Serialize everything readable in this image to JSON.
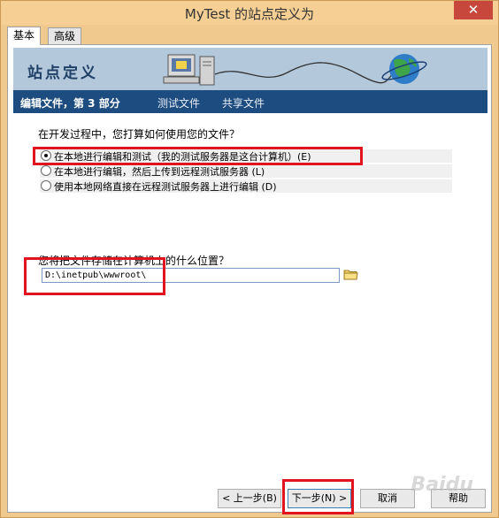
{
  "window": {
    "title": "MyTest 的站点定义为",
    "close_glyph": "✕"
  },
  "tabs": [
    {
      "label": "基本",
      "active": true
    },
    {
      "label": "高级",
      "active": false
    }
  ],
  "banner": {
    "title": "站点定义"
  },
  "steps": {
    "current": "编辑文件，第 3 部分",
    "others": [
      "测试文件",
      "共享文件"
    ]
  },
  "question1": "在开发过程中，您打算如何使用您的文件？",
  "options": [
    {
      "label": "在本地进行编辑和测试（我的测试服务器是这台计算机）(E)",
      "selected": true
    },
    {
      "label": "在本地进行编辑，然后上传到远程测试服务器 (L)",
      "selected": false
    },
    {
      "label": "使用本地网络直接在远程测试服务器上进行编辑 (D)",
      "selected": false
    }
  ],
  "question2": "您将把文件存储在计算机上的什么位置？",
  "path_input": {
    "value": "D:\\inetpub\\wwwroot\\"
  },
  "buttons": {
    "back": "< 上一步(B)",
    "next": "下一步(N) >",
    "cancel": "取消",
    "help": "帮助"
  },
  "watermark": "Baidu",
  "colors": {
    "highlight": "#e0131f",
    "stepbar": "#1d4c80",
    "banner": "#b4c8dc"
  }
}
